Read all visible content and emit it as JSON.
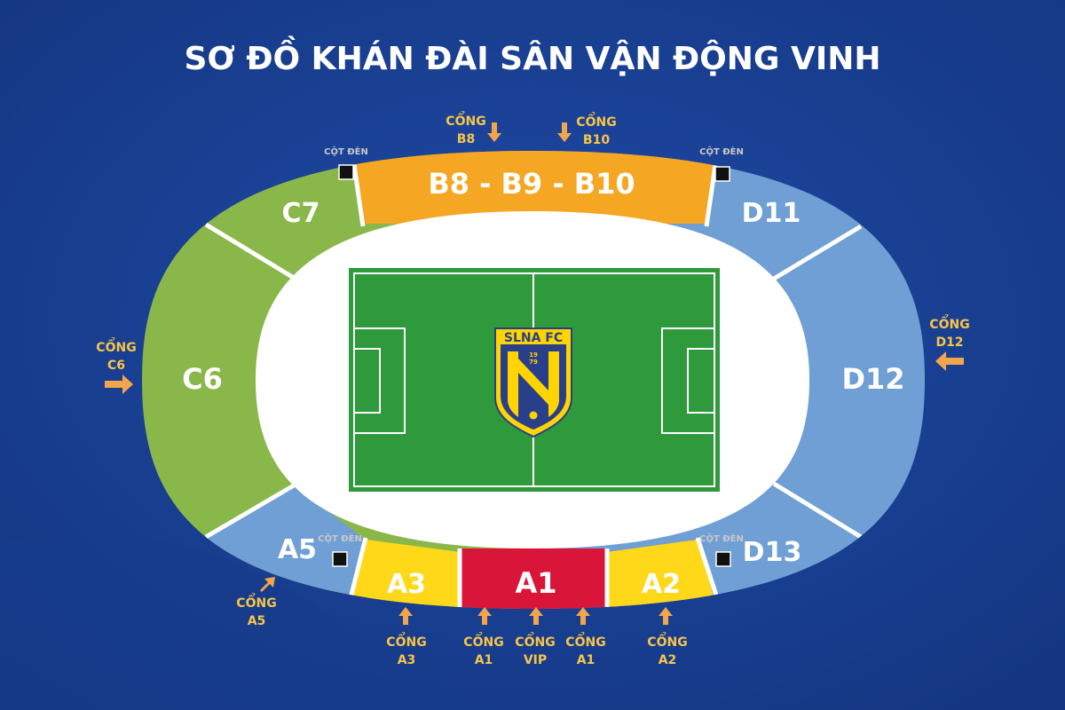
{
  "title": "SƠ ĐỒ KHÁN ĐÀI SÂN VẬN ĐỘNG VINH",
  "sections": {
    "b": "B8 - B9 - B10",
    "c7": "C7",
    "c6": "C6",
    "a5": "A5",
    "a3": "A3",
    "a1": "A1",
    "a2": "A2",
    "d13": "D13",
    "d12": "D12",
    "d11": "D11"
  },
  "gates": {
    "word": "CỔNG",
    "b8": "B8",
    "b10": "B10",
    "c6": "C6",
    "d12": "D12",
    "a5": "A5",
    "a3": "A3",
    "a1_left": "A1",
    "vip": "VIP",
    "a1_right": "A1",
    "a2": "A2"
  },
  "light_pole": "CỘT ĐÈN",
  "logo": {
    "name": "SLNA FC",
    "year_top": "19",
    "year_bottom": "79"
  },
  "colors": {
    "background": "#1a3f94",
    "stand_b": "#f5a623",
    "stand_c": "#8ab74a",
    "stand_d_a5": "#6f9fd4",
    "stand_a3_a2": "#ffd81a",
    "stand_a1": "#d9163a",
    "pitch": "#2f9a3c",
    "gate_text": "#f7c548",
    "arrow": "#f2a54c",
    "logo_navy": "#2a3f8a",
    "logo_yellow": "#ffd400"
  }
}
